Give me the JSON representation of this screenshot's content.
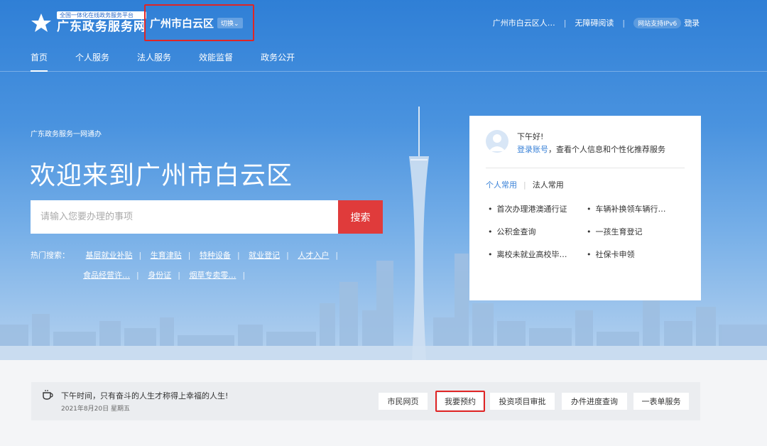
{
  "header": {
    "logo_tag": "全国一体化在线政务服务平台",
    "logo_name": "广东政务服务网",
    "region": "广州市白云区",
    "region_switch": "切换",
    "top_links": [
      "广州市白云区人…",
      "无障碍阅读",
      "网站支持IPv6"
    ],
    "login": "登录"
  },
  "nav": [
    "首页",
    "个人服务",
    "法人服务",
    "效能监督",
    "政务公开"
  ],
  "hero": {
    "subtitle": "广东政务服务一网通办",
    "title": "欢迎来到广州市白云区",
    "search_placeholder": "请输入您要办理的事项",
    "search_button": "搜索",
    "hot_label": "热门搜索：",
    "hot_row1": [
      "基层就业补贴",
      "生育津贴",
      "特种设备",
      "就业登记",
      "人才入户"
    ],
    "hot_row2": [
      "食品经营许…",
      "身份证",
      "烟草专卖零…"
    ]
  },
  "panel": {
    "greeting": "下午好!",
    "login_link": "登录账号",
    "login_tip": "，查看个人信息和个性化推荐服务",
    "tabs": [
      "个人常用",
      "法人常用"
    ],
    "items": [
      "首次办理港澳通行证",
      "车辆补换领车辆行…",
      "公积金查询",
      "一孩生育登记",
      "离校未就业高校毕…",
      "社保卡申领"
    ]
  },
  "bottom": {
    "motto": "下午时间，只有奋斗的人生才称得上幸福的人生!",
    "date": "2021年8月20日 星期五",
    "buttons": [
      "市民网页",
      "我要预约",
      "投资项目审批",
      "办件进度查询",
      "一表单服务"
    ]
  }
}
